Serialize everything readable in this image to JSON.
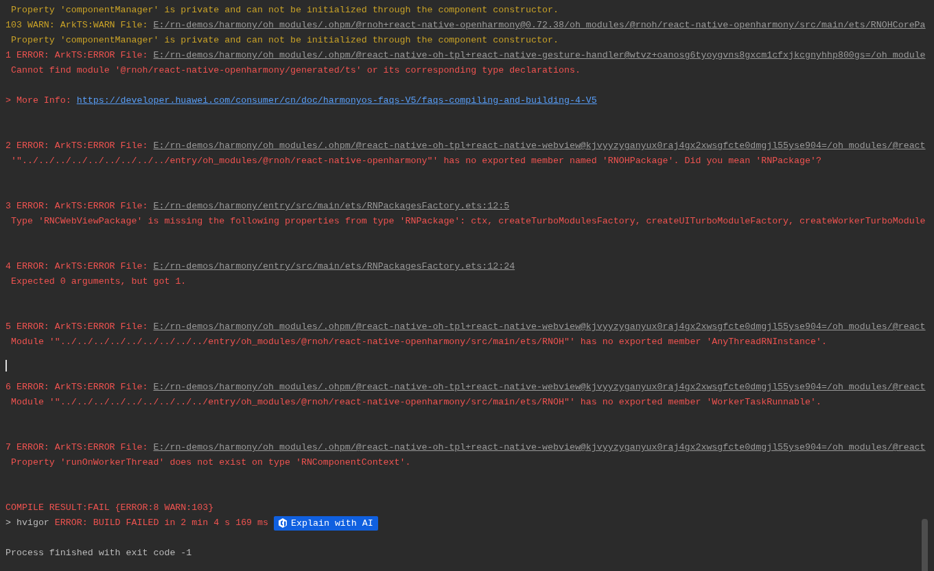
{
  "console": {
    "lines": [
      {
        "kind": "warn_message",
        "text": "Property 'componentManager' is private and can not be initialized through the component constructor."
      },
      {
        "kind": "warn_header",
        "prefix": "103 WARN: ArkTS:WARN File:",
        "link": "E:/rn-demos/harmony/oh_modules/.ohpm/@rnoh+react-native-openharmony@0.72.38/oh_modules/@rnoh/react-native-openharmony/src/main/ets/RNOHCorePa"
      },
      {
        "kind": "warn_message",
        "text": "Property 'componentManager' is private and can not be initialized through the component constructor."
      },
      {
        "kind": "error_header",
        "prefix": "1 ERROR: ArkTS:ERROR File:",
        "link": "E:/rn-demos/harmony/oh_modules/.ohpm/@react-native-oh-tpl+react-native-gesture-handler@wtvz+oanosg6tyoygvns8gxcm1cfxjkcgnyhhp800gs=/oh_module"
      },
      {
        "kind": "error_message",
        "text": "Cannot find module '@rnoh/react-native-openharmony/generated/ts' or its corresponding type declarations."
      },
      {
        "kind": "blank"
      },
      {
        "kind": "info",
        "prefix": "> More Info:",
        "link": "https://developer.huawei.com/consumer/cn/doc/harmonyos-faqs-V5/faqs-compiling-and-building-4-V5"
      },
      {
        "kind": "blank"
      },
      {
        "kind": "blank"
      },
      {
        "kind": "error_header",
        "prefix": "2 ERROR: ArkTS:ERROR File:",
        "link": "E:/rn-demos/harmony/oh_modules/.ohpm/@react-native-oh-tpl+react-native-webview@kjvyyzyganyux0raj4gx2xwsgfcte0dmgjl55yse904=/oh_modules/@react"
      },
      {
        "kind": "error_message",
        "text": "'\"../../../../../../../../../entry/oh_modules/@rnoh/react-native-openharmony\"' has no exported member named 'RNOHPackage'. Did you mean 'RNPackage'?"
      },
      {
        "kind": "blank"
      },
      {
        "kind": "blank"
      },
      {
        "kind": "error_header",
        "prefix": "3 ERROR: ArkTS:ERROR File:",
        "link": "E:/rn-demos/harmony/entry/src/main/ets/RNPackagesFactory.ets:12:5"
      },
      {
        "kind": "error_message",
        "text": "Type 'RNCWebViewPackage' is missing the following properties from type 'RNPackage': ctx, createTurboModulesFactory, createUITurboModuleFactory, createWorkerTurboModule"
      },
      {
        "kind": "blank"
      },
      {
        "kind": "blank"
      },
      {
        "kind": "error_header",
        "prefix": "4 ERROR: ArkTS:ERROR File:",
        "link": "E:/rn-demos/harmony/entry/src/main/ets/RNPackagesFactory.ets:12:24"
      },
      {
        "kind": "error_message",
        "text": "Expected 0 arguments, but got 1."
      },
      {
        "kind": "blank"
      },
      {
        "kind": "blank"
      },
      {
        "kind": "error_header",
        "prefix": "5 ERROR: ArkTS:ERROR File:",
        "link": "E:/rn-demos/harmony/oh_modules/.ohpm/@react-native-oh-tpl+react-native-webview@kjvyyzyganyux0raj4gx2xwsgfcte0dmgjl55yse904=/oh_modules/@react"
      },
      {
        "kind": "error_message",
        "text": "Module '\"../../../../../../../../../entry/oh_modules/@rnoh/react-native-openharmony/src/main/ets/RNOH\"' has no exported member 'AnyThreadRNInstance'."
      },
      {
        "kind": "blank"
      },
      {
        "kind": "cursor"
      },
      {
        "kind": "error_header",
        "prefix": "6 ERROR: ArkTS:ERROR File:",
        "link": "E:/rn-demos/harmony/oh_modules/.ohpm/@react-native-oh-tpl+react-native-webview@kjvyyzyganyux0raj4gx2xwsgfcte0dmgjl55yse904=/oh_modules/@react"
      },
      {
        "kind": "error_message",
        "text": "Module '\"../../../../../../../../../entry/oh_modules/@rnoh/react-native-openharmony/src/main/ets/RNOH\"' has no exported member 'WorkerTaskRunnable'."
      },
      {
        "kind": "blank"
      },
      {
        "kind": "blank"
      },
      {
        "kind": "error_header",
        "prefix": "7 ERROR: ArkTS:ERROR File:",
        "link": "E:/rn-demos/harmony/oh_modules/.ohpm/@react-native-oh-tpl+react-native-webview@kjvyyzyganyux0raj4gx2xwsgfcte0dmgjl55yse904=/oh_modules/@react"
      },
      {
        "kind": "error_message",
        "text": "Property 'runOnWorkerThread' does not exist on type 'RNComponentContext'."
      },
      {
        "kind": "blank"
      },
      {
        "kind": "blank"
      },
      {
        "kind": "result",
        "text": "COMPILE RESULT:FAIL {ERROR:8 WARN:103}"
      },
      {
        "kind": "build_status",
        "prompt": "> hvigor",
        "text": "ERROR: BUILD FAILED in 2 min 4 s 169 ms",
        "button": "Explain with AI"
      },
      {
        "kind": "blank"
      },
      {
        "kind": "plain",
        "text": "Process finished with exit code -1"
      }
    ]
  }
}
